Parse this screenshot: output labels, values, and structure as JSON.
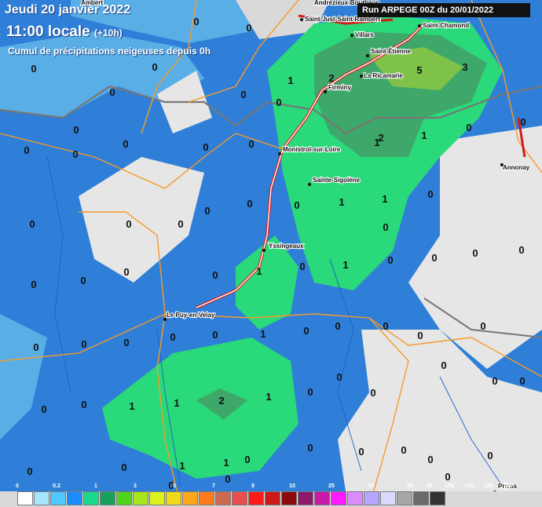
{
  "header": {
    "date": "Jeudi 20 janvier 2022",
    "time": "11:00 locale",
    "offset": "(+10h)",
    "subtitle": "Cumul de précipitations neigeuses depuis 0h",
    "run": "Run ARPEGE 00Z du 20/01/2022"
  },
  "cities": [
    {
      "name": "Ambert"
    },
    {
      "name": "Andrézieux-Bouthéon"
    },
    {
      "name": "Saint-Just-Saint-Rambert"
    },
    {
      "name": "Villars"
    },
    {
      "name": "Saint-Chamond"
    },
    {
      "name": "Saint-Étienne"
    },
    {
      "name": "La Ricamarie"
    },
    {
      "name": "Firminy"
    },
    {
      "name": "Monistrol-sur-Loire"
    },
    {
      "name": "Sainte-Sigolène"
    },
    {
      "name": "Annonay"
    },
    {
      "name": "Yssingeaux"
    },
    {
      "name": "Le Puy-en-Velay"
    },
    {
      "name": "Privas"
    }
  ],
  "values": [
    "0",
    "1",
    "2",
    "3",
    "5"
  ],
  "legend": {
    "ticks": [
      "0",
      "0.2",
      "1",
      "3",
      "5",
      "7",
      "9",
      "15",
      "25",
      "40",
      "60",
      "80",
      "100",
      "140",
      "180",
      "250"
    ],
    "colors": [
      "#ffffff",
      "#a6e6ff",
      "#4fc8ff",
      "#1a8cff",
      "#1ad98c",
      "#1aa05a",
      "#52d41a",
      "#a6e61a",
      "#d9f21a",
      "#f2d91a",
      "#ffa61a",
      "#ff7a1a",
      "#cc6a4f",
      "#e64f4f",
      "#ff1a1a",
      "#cc1a1a",
      "#8c0a0a",
      "#8c1a6a",
      "#c71aa6",
      "#ff1aff",
      "#d98cff",
      "#b8a6ff",
      "#d9d9ff",
      "#a6a6a6",
      "#6a6a6a",
      "#333333"
    ]
  }
}
